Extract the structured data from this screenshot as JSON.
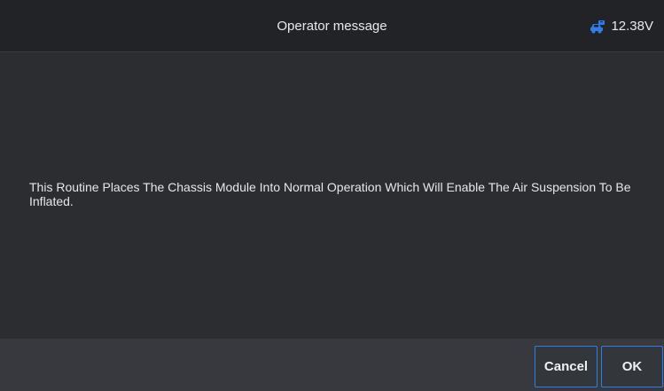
{
  "header": {
    "title": "Operator message",
    "voltage": "12.38V",
    "voltage_icon": "vehicle-battery-icon",
    "accent_color": "#2f7ee8"
  },
  "message": {
    "text": "This Routine Places The Chassis Module Into Normal Operation Which Will Enable The Air Suspension To Be Inflated."
  },
  "footer": {
    "cancel_label": "Cancel",
    "ok_label": "OK"
  }
}
